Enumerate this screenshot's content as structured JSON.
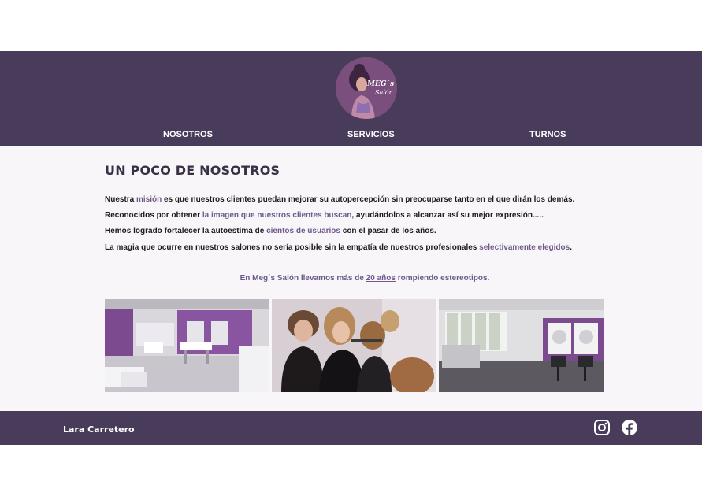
{
  "header": {
    "logo_title": "MEG´s",
    "logo_subtitle": "Salón",
    "nav": [
      {
        "label": "NOSOTROS"
      },
      {
        "label": "SERVICIOS"
      },
      {
        "label": "TURNOS"
      }
    ]
  },
  "main": {
    "title": "UN POCO DE NOSOTROS",
    "p1": {
      "a": "Nuestra ",
      "b": "misión",
      "c": " es que nuestros clientes puedan mejorar su autopercepción sin preocuparse tanto en el que dirán los demás."
    },
    "p2": {
      "a": "Reconocidos por  obtener ",
      "b": "la imagen que nuestros clientes buscan",
      "c": ", ayudándolos a alcanzar así su mejor expresión....."
    },
    "p3": {
      "a": "Hemos logrado fortalecer la autoestima de ",
      "b": "cientos de usuarios",
      "c": " con el pasar de los años."
    },
    "p4": {
      "a": "La magia que ocurre en nuestros salones no sería posible sin la empatía de nuestros profesionales ",
      "b": "selectivamente elegidos",
      "c": "."
    },
    "tagline": {
      "a": "En Meg´s Salón llevamos más de ",
      "b": "20 años",
      "c": " rompiendo estereotipos."
    },
    "photos": [
      {
        "icon": "salon-interior-photo"
      },
      {
        "icon": "stylists-working-photo"
      },
      {
        "icon": "salon-stations-photo"
      }
    ]
  },
  "footer": {
    "author": "Lara Carretero",
    "social": [
      {
        "icon": "instagram-icon"
      },
      {
        "icon": "facebook-icon"
      }
    ]
  },
  "colors": {
    "header_bg": "#493c5b",
    "accent": "#6e5a8c",
    "page_bg": "#f8f6f8"
  }
}
